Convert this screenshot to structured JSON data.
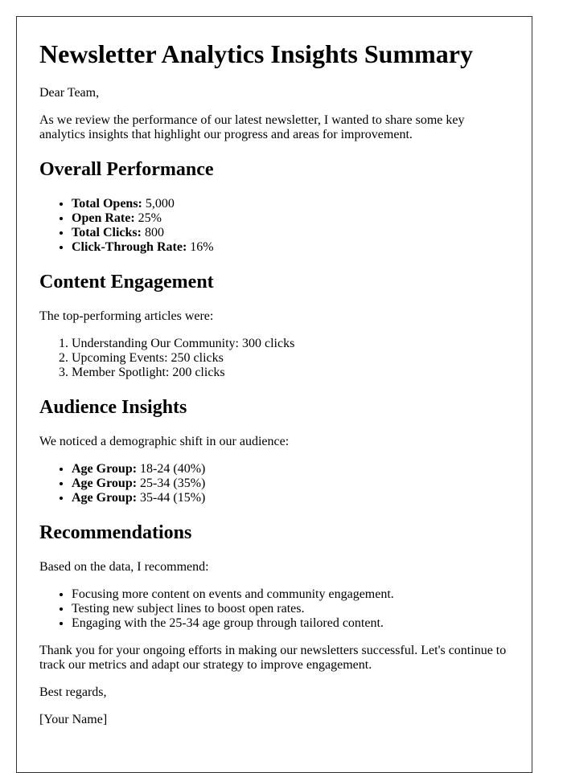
{
  "document": {
    "title": "Newsletter Analytics Insights Summary",
    "greeting": "Dear Team,",
    "intro": "As we review the performance of our latest newsletter, I wanted to share some key analytics insights that highlight our progress and areas for improvement.",
    "sections": {
      "overall": {
        "heading": "Overall Performance",
        "metrics": [
          {
            "label": "Total Opens:",
            "value": " 5,000"
          },
          {
            "label": "Open Rate:",
            "value": " 25%"
          },
          {
            "label": "Total Clicks:",
            "value": " 800"
          },
          {
            "label": "Click-Through Rate:",
            "value": " 16%"
          }
        ]
      },
      "content": {
        "heading": "Content Engagement",
        "intro": "The top-performing articles were:",
        "articles": [
          "Understanding Our Community: 300 clicks",
          "Upcoming Events: 250 clicks",
          "Member Spotlight: 200 clicks"
        ]
      },
      "audience": {
        "heading": "Audience Insights",
        "intro": "We noticed a demographic shift in our audience:",
        "groups": [
          {
            "label": "Age Group:",
            "value": " 18-24 (40%)"
          },
          {
            "label": "Age Group:",
            "value": " 25-34 (35%)"
          },
          {
            "label": "Age Group:",
            "value": " 35-44 (15%)"
          }
        ]
      },
      "recommendations": {
        "heading": "Recommendations",
        "intro": "Based on the data, I recommend:",
        "items": [
          "Focusing more content on events and community engagement.",
          "Testing new subject lines to boost open rates.",
          "Engaging with the 25-34 age group through tailored content."
        ]
      }
    },
    "closing": "Thank you for your ongoing efforts in making our newsletters successful. Let's continue to track our metrics and adapt our strategy to improve engagement.",
    "signoff": "Best regards,",
    "signature": "[Your Name]"
  }
}
